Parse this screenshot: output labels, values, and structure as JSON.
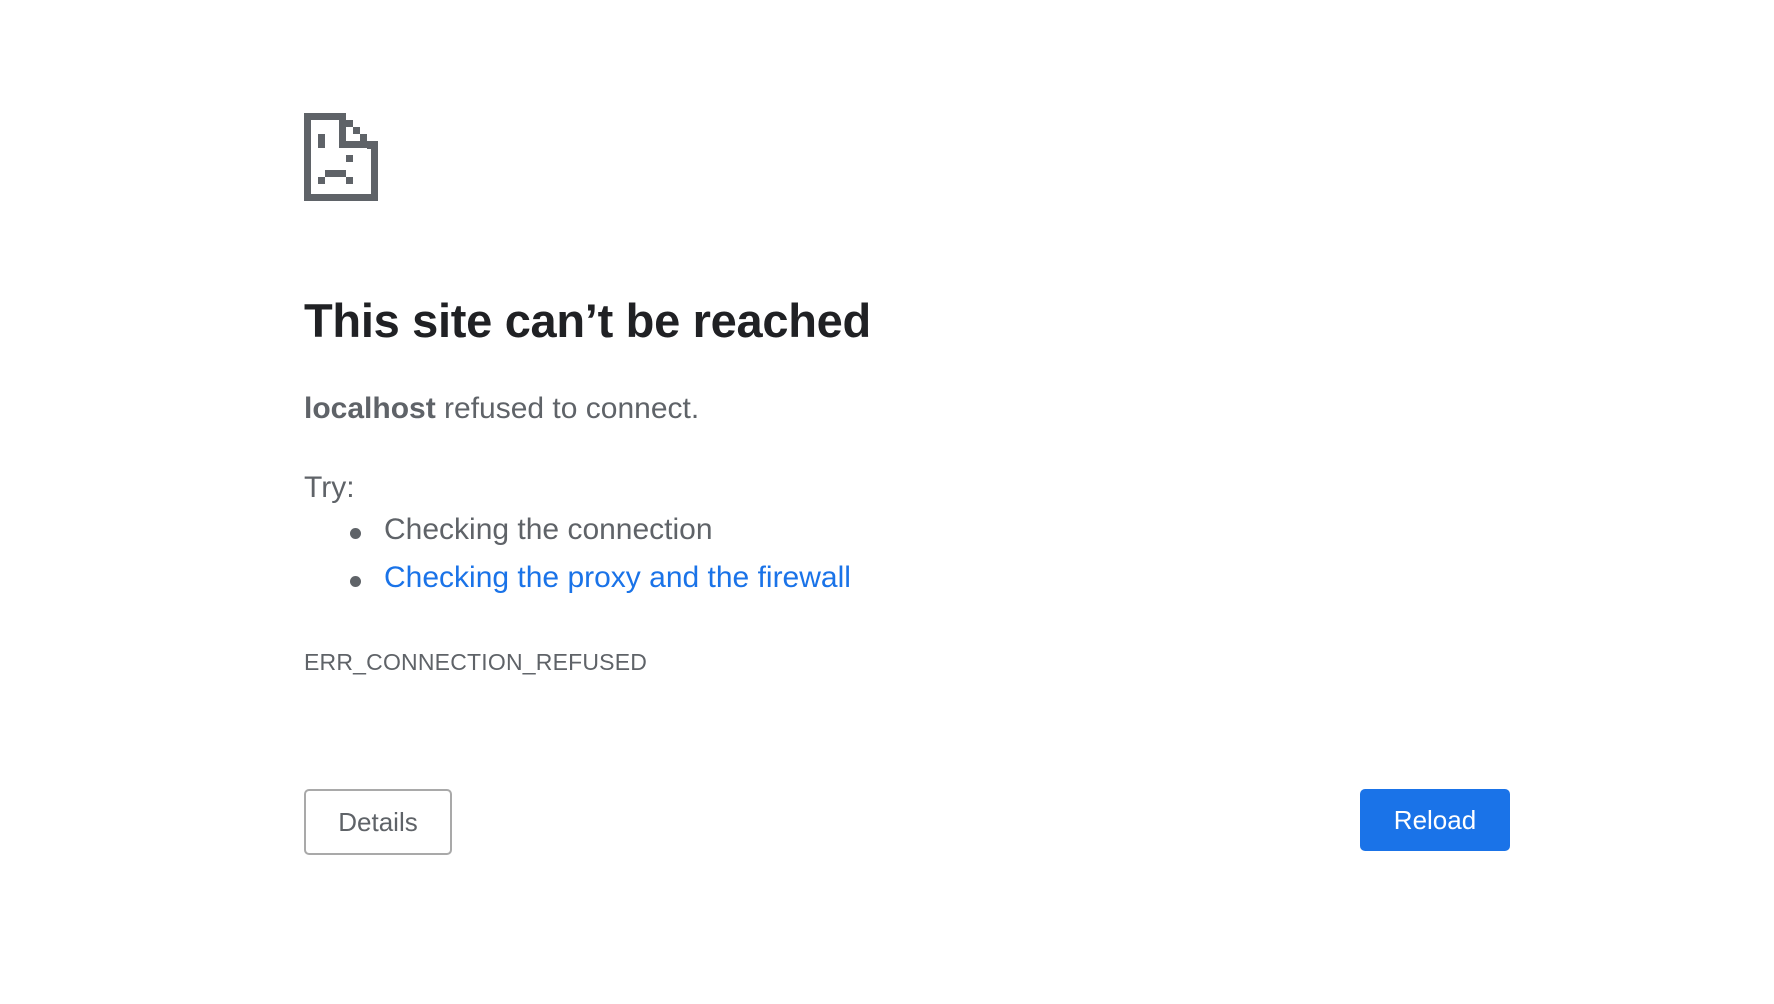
{
  "error_page": {
    "icon": "sad-document-icon",
    "title": "This site can’t be reached",
    "summary_host": "localhost",
    "summary_rest": " refused to connect.",
    "try_label": "Try:",
    "suggestions": [
      {
        "text": "Checking the connection",
        "is_link": false
      },
      {
        "text": "Checking the proxy and the firewall",
        "is_link": true
      }
    ],
    "error_code": "ERR_CONNECTION_REFUSED",
    "details_button": "Details",
    "reload_button": "Reload"
  },
  "colors": {
    "title": "#202124",
    "body_text": "#5f6368",
    "link": "#1a73e8",
    "primary_button": "#1a73e8",
    "button_border": "#a9a9a9",
    "background": "#ffffff"
  }
}
